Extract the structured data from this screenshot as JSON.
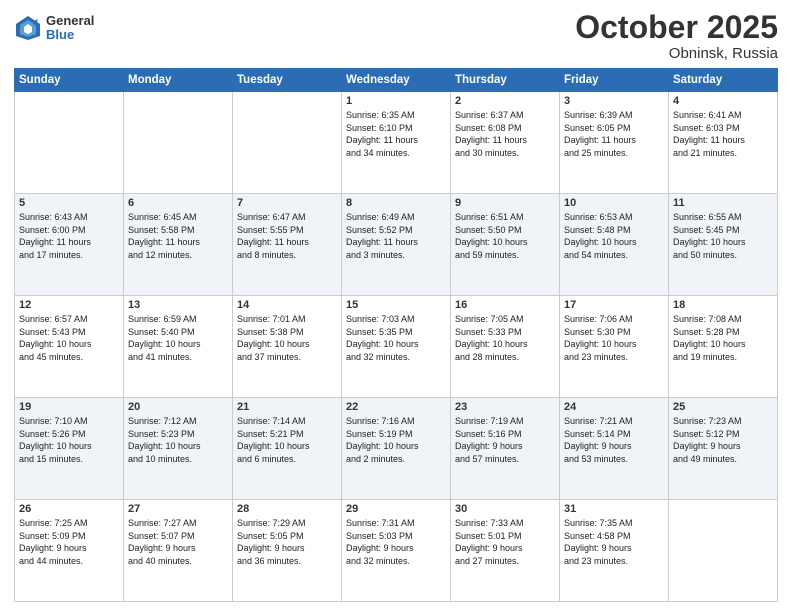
{
  "logo": {
    "general": "General",
    "blue": "Blue"
  },
  "header": {
    "month": "October 2025",
    "location": "Obninsk, Russia"
  },
  "weekdays": [
    "Sunday",
    "Monday",
    "Tuesday",
    "Wednesday",
    "Thursday",
    "Friday",
    "Saturday"
  ],
  "weeks": [
    [
      {
        "day": "",
        "info": ""
      },
      {
        "day": "",
        "info": ""
      },
      {
        "day": "",
        "info": ""
      },
      {
        "day": "1",
        "info": "Sunrise: 6:35 AM\nSunset: 6:10 PM\nDaylight: 11 hours\nand 34 minutes."
      },
      {
        "day": "2",
        "info": "Sunrise: 6:37 AM\nSunset: 6:08 PM\nDaylight: 11 hours\nand 30 minutes."
      },
      {
        "day": "3",
        "info": "Sunrise: 6:39 AM\nSunset: 6:05 PM\nDaylight: 11 hours\nand 25 minutes."
      },
      {
        "day": "4",
        "info": "Sunrise: 6:41 AM\nSunset: 6:03 PM\nDaylight: 11 hours\nand 21 minutes."
      }
    ],
    [
      {
        "day": "5",
        "info": "Sunrise: 6:43 AM\nSunset: 6:00 PM\nDaylight: 11 hours\nand 17 minutes."
      },
      {
        "day": "6",
        "info": "Sunrise: 6:45 AM\nSunset: 5:58 PM\nDaylight: 11 hours\nand 12 minutes."
      },
      {
        "day": "7",
        "info": "Sunrise: 6:47 AM\nSunset: 5:55 PM\nDaylight: 11 hours\nand 8 minutes."
      },
      {
        "day": "8",
        "info": "Sunrise: 6:49 AM\nSunset: 5:52 PM\nDaylight: 11 hours\nand 3 minutes."
      },
      {
        "day": "9",
        "info": "Sunrise: 6:51 AM\nSunset: 5:50 PM\nDaylight: 10 hours\nand 59 minutes."
      },
      {
        "day": "10",
        "info": "Sunrise: 6:53 AM\nSunset: 5:48 PM\nDaylight: 10 hours\nand 54 minutes."
      },
      {
        "day": "11",
        "info": "Sunrise: 6:55 AM\nSunset: 5:45 PM\nDaylight: 10 hours\nand 50 minutes."
      }
    ],
    [
      {
        "day": "12",
        "info": "Sunrise: 6:57 AM\nSunset: 5:43 PM\nDaylight: 10 hours\nand 45 minutes."
      },
      {
        "day": "13",
        "info": "Sunrise: 6:59 AM\nSunset: 5:40 PM\nDaylight: 10 hours\nand 41 minutes."
      },
      {
        "day": "14",
        "info": "Sunrise: 7:01 AM\nSunset: 5:38 PM\nDaylight: 10 hours\nand 37 minutes."
      },
      {
        "day": "15",
        "info": "Sunrise: 7:03 AM\nSunset: 5:35 PM\nDaylight: 10 hours\nand 32 minutes."
      },
      {
        "day": "16",
        "info": "Sunrise: 7:05 AM\nSunset: 5:33 PM\nDaylight: 10 hours\nand 28 minutes."
      },
      {
        "day": "17",
        "info": "Sunrise: 7:06 AM\nSunset: 5:30 PM\nDaylight: 10 hours\nand 23 minutes."
      },
      {
        "day": "18",
        "info": "Sunrise: 7:08 AM\nSunset: 5:28 PM\nDaylight: 10 hours\nand 19 minutes."
      }
    ],
    [
      {
        "day": "19",
        "info": "Sunrise: 7:10 AM\nSunset: 5:26 PM\nDaylight: 10 hours\nand 15 minutes."
      },
      {
        "day": "20",
        "info": "Sunrise: 7:12 AM\nSunset: 5:23 PM\nDaylight: 10 hours\nand 10 minutes."
      },
      {
        "day": "21",
        "info": "Sunrise: 7:14 AM\nSunset: 5:21 PM\nDaylight: 10 hours\nand 6 minutes."
      },
      {
        "day": "22",
        "info": "Sunrise: 7:16 AM\nSunset: 5:19 PM\nDaylight: 10 hours\nand 2 minutes."
      },
      {
        "day": "23",
        "info": "Sunrise: 7:19 AM\nSunset: 5:16 PM\nDaylight: 9 hours\nand 57 minutes."
      },
      {
        "day": "24",
        "info": "Sunrise: 7:21 AM\nSunset: 5:14 PM\nDaylight: 9 hours\nand 53 minutes."
      },
      {
        "day": "25",
        "info": "Sunrise: 7:23 AM\nSunset: 5:12 PM\nDaylight: 9 hours\nand 49 minutes."
      }
    ],
    [
      {
        "day": "26",
        "info": "Sunrise: 7:25 AM\nSunset: 5:09 PM\nDaylight: 9 hours\nand 44 minutes."
      },
      {
        "day": "27",
        "info": "Sunrise: 7:27 AM\nSunset: 5:07 PM\nDaylight: 9 hours\nand 40 minutes."
      },
      {
        "day": "28",
        "info": "Sunrise: 7:29 AM\nSunset: 5:05 PM\nDaylight: 9 hours\nand 36 minutes."
      },
      {
        "day": "29",
        "info": "Sunrise: 7:31 AM\nSunset: 5:03 PM\nDaylight: 9 hours\nand 32 minutes."
      },
      {
        "day": "30",
        "info": "Sunrise: 7:33 AM\nSunset: 5:01 PM\nDaylight: 9 hours\nand 27 minutes."
      },
      {
        "day": "31",
        "info": "Sunrise: 7:35 AM\nSunset: 4:58 PM\nDaylight: 9 hours\nand 23 minutes."
      },
      {
        "day": "",
        "info": ""
      }
    ]
  ]
}
